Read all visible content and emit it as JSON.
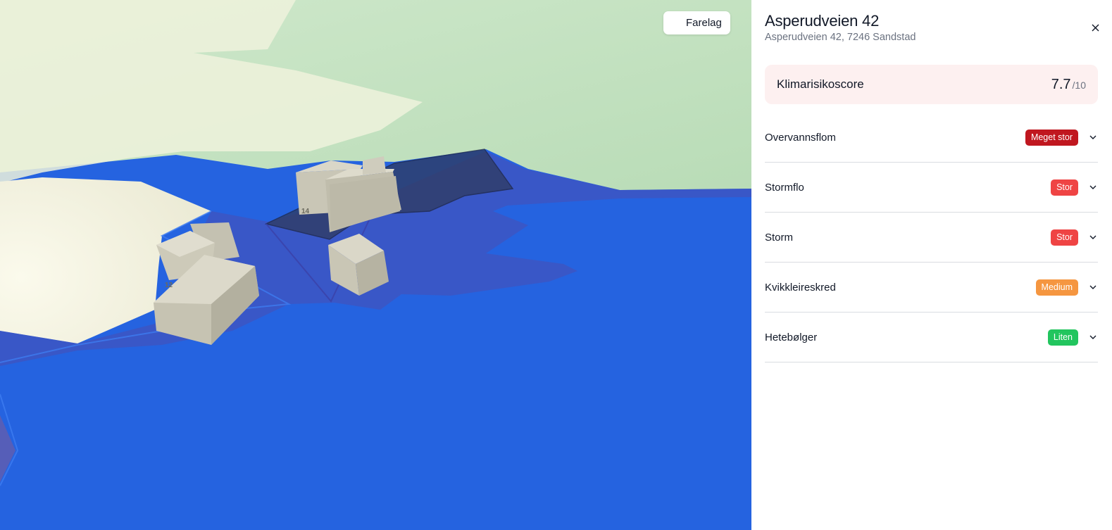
{
  "map": {
    "layers_button_label": "Farelag",
    "layers_icon": "sliders-icon",
    "lot_labels": [
      "14",
      "12"
    ]
  },
  "panel": {
    "title": "Asperudveien 42",
    "subtitle": "Asperudveien 42, 7246 Sandstad",
    "close_icon": "close-icon",
    "score": {
      "label": "Klimarisikoscore",
      "value": "7.7",
      "max": "/10"
    },
    "risks": [
      {
        "name": "Overvannsflom",
        "level": "Meget stor",
        "color": "#c0171f"
      },
      {
        "name": "Stormflo",
        "level": "Stor",
        "color": "#ef4444"
      },
      {
        "name": "Storm",
        "level": "Stor",
        "color": "#ef4444"
      },
      {
        "name": "Kvikkleireskred",
        "level": "Medium",
        "color": "#f59640"
      },
      {
        "name": "Hetebølger",
        "level": "Liten",
        "color": "#22c55e"
      }
    ],
    "expand_icon": "chevron-down-icon"
  },
  "colors": {
    "flood_water": "#2563e0",
    "land_light": "#f7f5e3",
    "land_green": "#c5e3c3"
  }
}
